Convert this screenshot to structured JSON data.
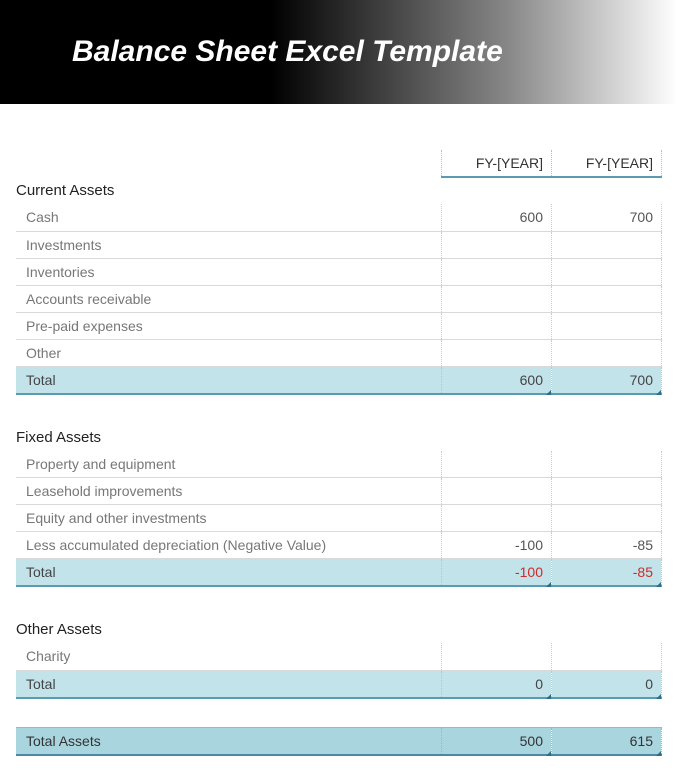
{
  "header": {
    "title": "Balance Sheet Excel Template"
  },
  "columns": {
    "year1": "FY-[YEAR]",
    "year2": "FY-[YEAR]"
  },
  "sections": {
    "current": {
      "title": "Current Assets",
      "rows": {
        "cash": {
          "label": "Cash",
          "y1": "600",
          "y2": "700"
        },
        "investments": {
          "label": "Investments",
          "y1": "",
          "y2": ""
        },
        "inventories": {
          "label": "Inventories",
          "y1": "",
          "y2": ""
        },
        "ar": {
          "label": "Accounts receivable",
          "y1": "",
          "y2": ""
        },
        "prepaid": {
          "label": "Pre-paid expenses",
          "y1": "",
          "y2": ""
        },
        "other": {
          "label": "Other",
          "y1": "",
          "y2": ""
        }
      },
      "total": {
        "label": "Total",
        "y1": "600",
        "y2": "700"
      }
    },
    "fixed": {
      "title": "Fixed Assets",
      "rows": {
        "property": {
          "label": "Property and equipment",
          "y1": "",
          "y2": ""
        },
        "leasehold": {
          "label": "Leasehold improvements",
          "y1": "",
          "y2": ""
        },
        "equity": {
          "label": "Equity and other investments",
          "y1": "",
          "y2": ""
        },
        "deprec": {
          "label": "Less accumulated depreciation (Negative Value)",
          "y1": "-100",
          "y2": "-85"
        }
      },
      "total": {
        "label": "Total",
        "y1": "-100",
        "y2": "-85"
      }
    },
    "other": {
      "title": "Other Assets",
      "rows": {
        "charity": {
          "label": "Charity",
          "y1": "",
          "y2": ""
        }
      },
      "total": {
        "label": "Total",
        "y1": "0",
        "y2": "0"
      }
    }
  },
  "grand": {
    "label": "Total Assets",
    "y1": "500",
    "y2": "615"
  }
}
